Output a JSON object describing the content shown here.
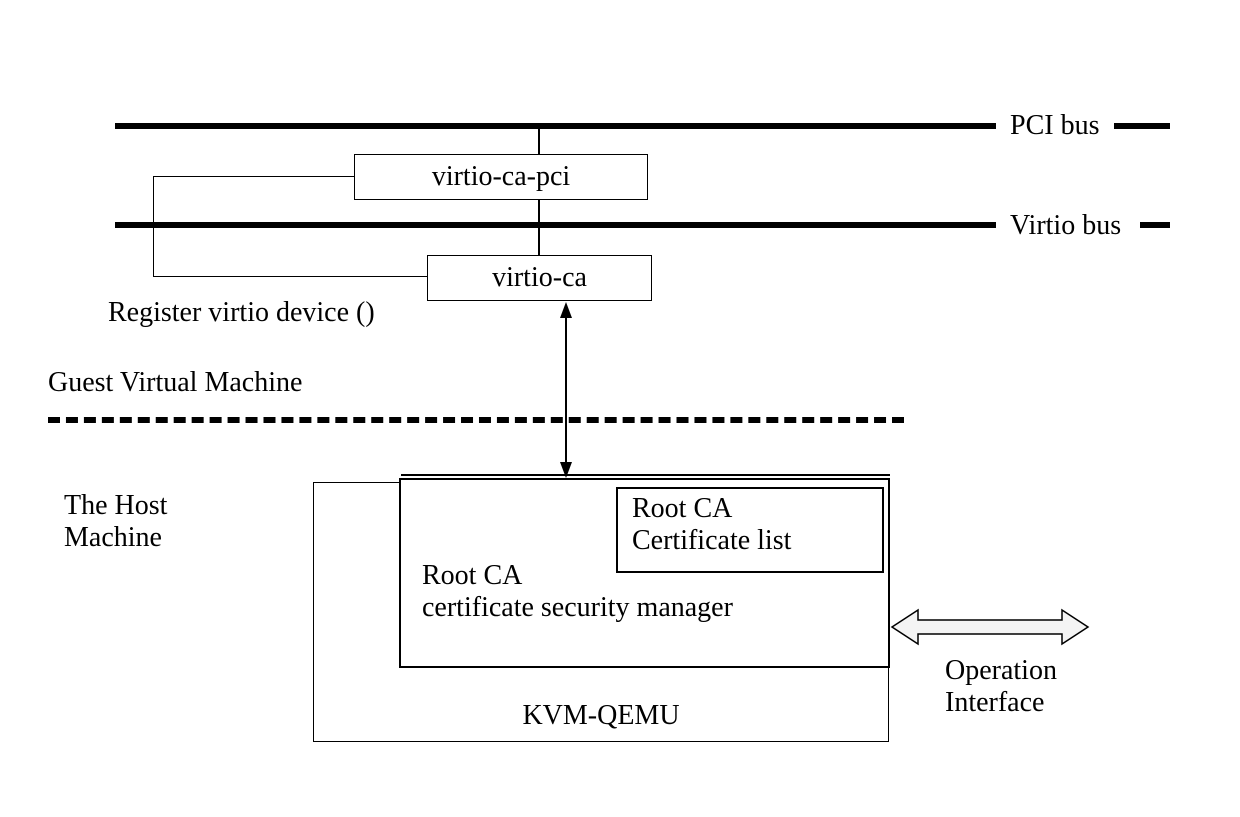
{
  "busLabels": {
    "pci": "PCI bus",
    "virtio": "Virtio bus"
  },
  "boxes": {
    "virtioCaPci": "virtio-ca-pci",
    "virtioCa": "virtio-ca",
    "rootCaCertList_line1": "Root CA",
    "rootCaCertList_line2": "Certificate list",
    "rootCaSecMgr_line1": "Root CA",
    "rootCaSecMgr_line2": "certificate security manager",
    "kvmQemu": "KVM-QEMU"
  },
  "textLabels": {
    "registerVirtio": "Register virtio device ()",
    "guestVM": "Guest Virtual Machine",
    "hostMachine_line1": "The Host",
    "hostMachine_line2": "Machine",
    "operationInterface_line1": "Operation",
    "operationInterface_line2": "Interface"
  }
}
